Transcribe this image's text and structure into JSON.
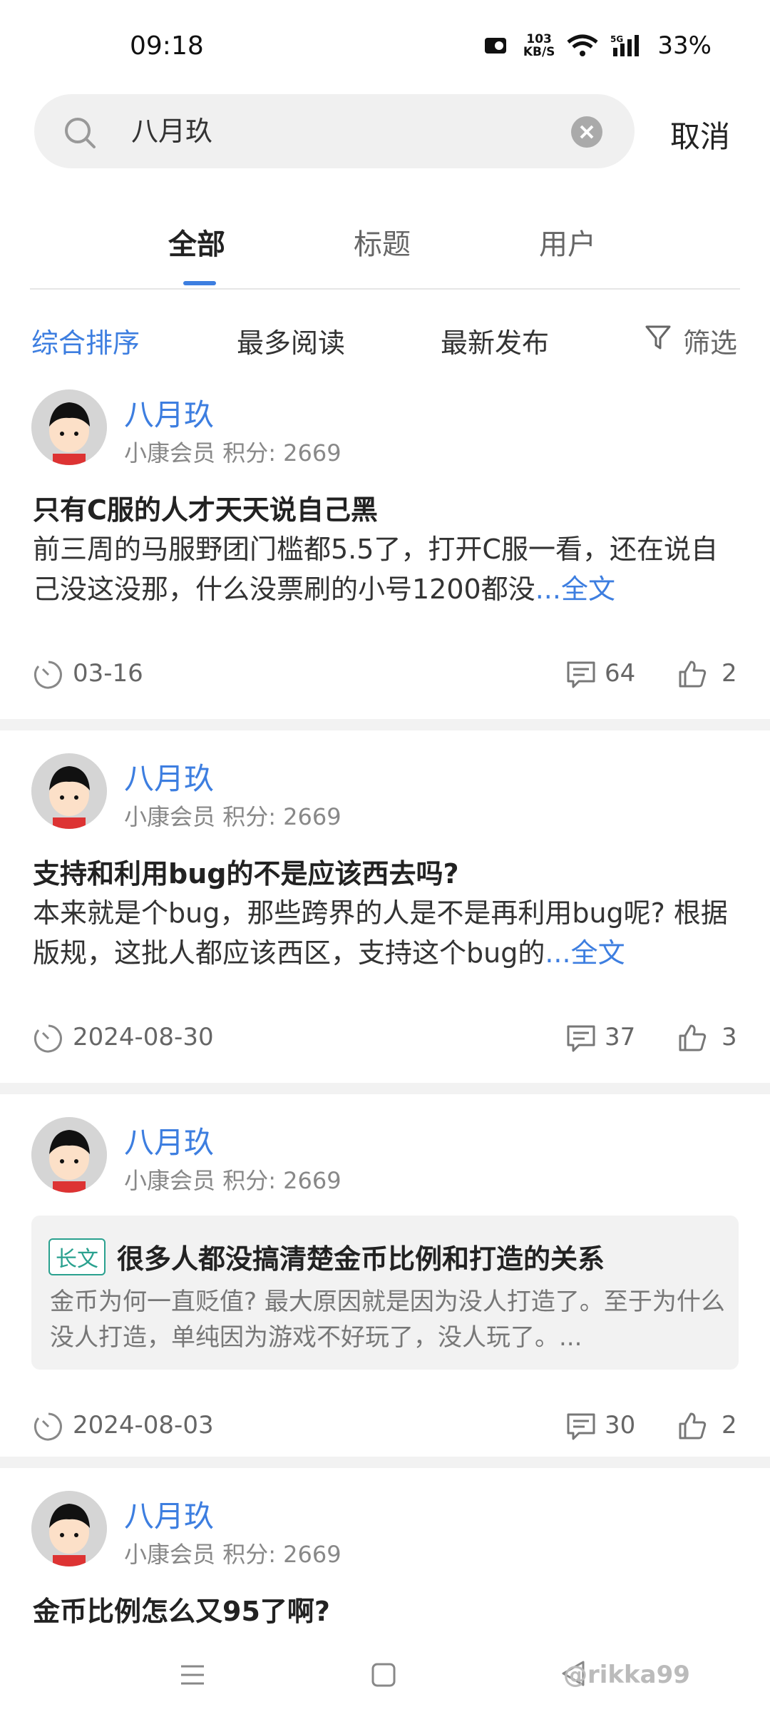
{
  "status_bar": {
    "time": "09:18",
    "net_speed_value": "103",
    "net_speed_unit": "KB/S",
    "network": "5G",
    "battery": "33%"
  },
  "search": {
    "value": "八月玖",
    "cancel_label": "取消"
  },
  "tabs": [
    {
      "label": "全部"
    },
    {
      "label": "标题"
    },
    {
      "label": "用户"
    }
  ],
  "sort": {
    "items": [
      {
        "label": "综合排序"
      },
      {
        "label": "最多阅读"
      },
      {
        "label": "最新发布"
      }
    ],
    "filter_label": "筛选"
  },
  "posts": [
    {
      "username": "八月玖",
      "member_level": "小康会员",
      "points_label": "积分: 2669",
      "title": "只有C服的人才天天说自己黑",
      "body": "前三周的马服野团门槛都5.5了，打开C服一看，还在说自己没这没那，什么没票刷的小号1200都没",
      "more_label": "...全文",
      "date": "03-16",
      "comments": "64",
      "likes": "2"
    },
    {
      "username": "八月玖",
      "member_level": "小康会员",
      "points_label": "积分: 2669",
      "title": "支持和利用bug的不是应该西去吗?",
      "body": "本来就是个bug，那些跨界的人是不是再利用bug呢? 根据版规，这批人都应该西区，支持这个bug的",
      "more_label": "...全文",
      "date": "2024-08-30",
      "comments": "37",
      "likes": "3"
    },
    {
      "username": "八月玖",
      "member_level": "小康会员",
      "points_label": "积分: 2669",
      "badge": "长文",
      "title": "很多人都没搞清楚金币比例和打造的关系",
      "body": "金币为何一直贬值? 最大原因就是因为没人打造了。至于为什么没人打造，单纯因为游戏不好玩了，没人玩了。...",
      "date": "2024-08-03",
      "comments": "30",
      "likes": "2"
    },
    {
      "username": "八月玖",
      "member_level": "小康会员",
      "points_label": "积分: 2669",
      "title": "金币比例怎么又95了啊?"
    }
  ],
  "watermark": "@rikka99",
  "colors": {
    "accent": "#3d7ee0",
    "badge": "#2aa18f"
  }
}
